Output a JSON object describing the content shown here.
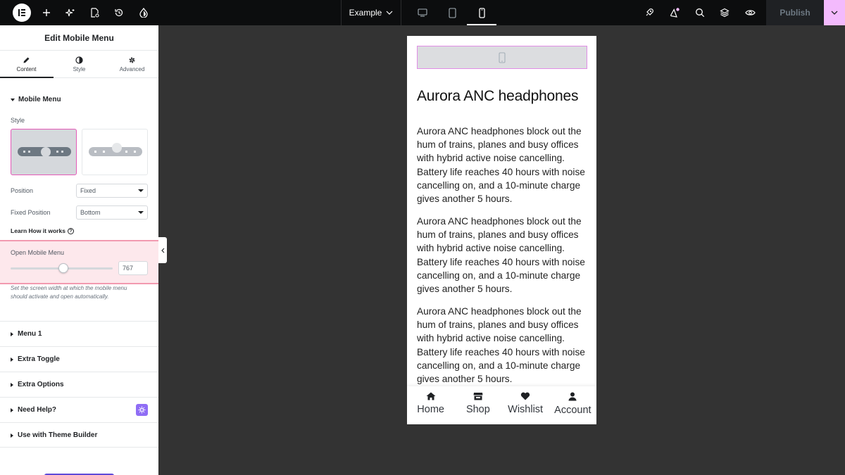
{
  "topbar": {
    "site_name": "Example",
    "publish_label": "Publish",
    "icons": [
      "elementor-logo-icon",
      "add-icon",
      "ai-sparkle-icon",
      "page-settings-icon",
      "history-icon",
      "site-settings-icon",
      "desktop-icon",
      "tablet-icon",
      "mobile-icon",
      "rocket-icon",
      "notifications-icon",
      "search-icon",
      "structure-icon",
      "preview-icon",
      "chevron-down-icon"
    ],
    "active_device": "mobile"
  },
  "panel": {
    "title": "Edit Mobile Menu",
    "tabs": [
      {
        "label": "Content",
        "icon": "pencil-icon",
        "active": true
      },
      {
        "label": "Style",
        "icon": "contrast-icon",
        "active": false
      },
      {
        "label": "Advanced",
        "icon": "gear-icon",
        "active": false
      }
    ],
    "section_title": "Mobile Menu",
    "style_label": "Style",
    "position_label": "Position",
    "position_value": "Fixed",
    "fixed_position_label": "Fixed Position",
    "fixed_position_value": "Bottom",
    "learn_link": "Learn How it works",
    "open_menu_label": "Open Mobile Menu",
    "open_menu_value": "767",
    "open_menu_slider_fraction": 0.52,
    "description": "Set the screen width at which the mobile menu should activate and open automatically.",
    "accordions": [
      "Menu 1",
      "Extra Toggle",
      "Extra Options",
      "Need Help?",
      "Use with Theme Builder"
    ]
  },
  "preview": {
    "heading": "Aurora ANC headphones",
    "paragraphs": [
      "Aurora ANC headphones block out the hum of trains, planes and busy offices with hybrid active noise cancelling. Battery life reaches 40 hours with noise cancelling on, and a 10-minute charge gives another 5 hours.",
      "Aurora ANC headphones block out the hum of trains, planes and busy offices with hybrid active noise cancelling. Battery life reaches 40 hours with noise cancelling on, and a 10-minute charge gives another 5 hours.",
      "Aurora ANC headphones block out the hum of trains, planes and busy offices with hybrid active noise cancelling. Battery life reaches 40 hours with noise cancelling on, and a 10-minute charge gives another 5 hours."
    ],
    "nav": [
      {
        "label": "Home",
        "icon": "home-icon"
      },
      {
        "label": "Shop",
        "icon": "store-icon"
      },
      {
        "label": "Wishlist",
        "icon": "heart-icon"
      },
      {
        "label": "Account",
        "icon": "user-icon"
      }
    ]
  },
  "colors": {
    "topbar_bg": "#0c0d0e",
    "canvas_bg": "#333333",
    "accent_pink": "#f3bafd",
    "highlight_bg": "#fde8ec",
    "help_badge": "#8f6df5"
  }
}
